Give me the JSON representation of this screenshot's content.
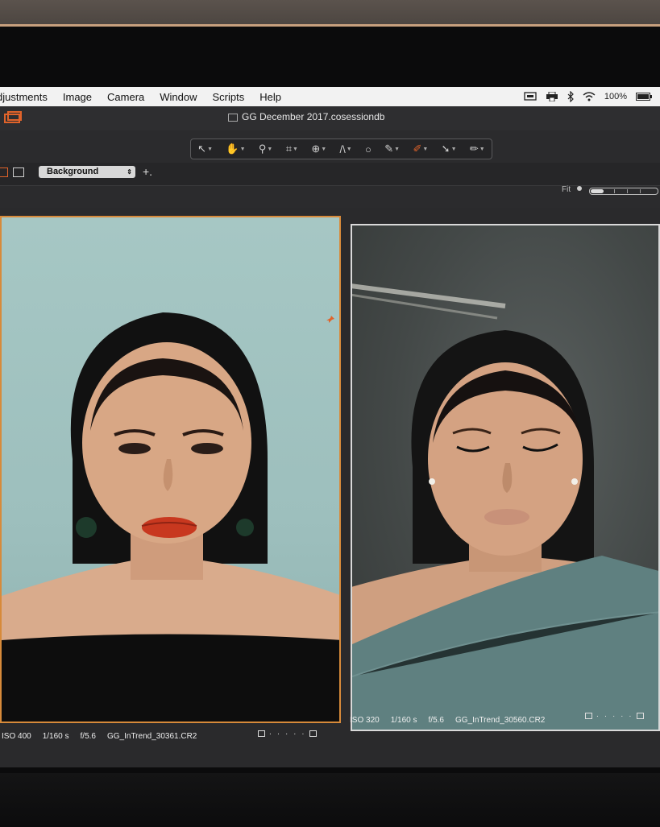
{
  "menu": {
    "items": [
      "djustments",
      "Image",
      "Camera",
      "Window",
      "Scripts",
      "Help"
    ],
    "battery": "100%"
  },
  "document": {
    "title": "GG December 2017.cosessiondb"
  },
  "toolbar": {
    "tools": [
      "cursor-icon",
      "pan-icon",
      "zoom-icon",
      "crop-icon",
      "rotate-icon",
      "keystone-icon",
      "spot-icon",
      "brush-icon",
      "eraser-icon",
      "picker-icon",
      "pen-icon"
    ]
  },
  "viewer": {
    "layer": "Background",
    "fit_label": "Fit"
  },
  "images": [
    {
      "iso": "ISO 400",
      "shutter": "1/160 s",
      "aperture": "f/5.6",
      "filename": "GG_InTrend_30361.CR2"
    },
    {
      "iso": "ISO 320",
      "shutter": "1/160 s",
      "aperture": "f/5.6",
      "filename": "GG_InTrend_30560.CR2"
    }
  ],
  "colors": {
    "selected_frame": "#d78a3a",
    "secondary_frame": "#d9d9d9",
    "menubar": "#f2f2f2"
  }
}
